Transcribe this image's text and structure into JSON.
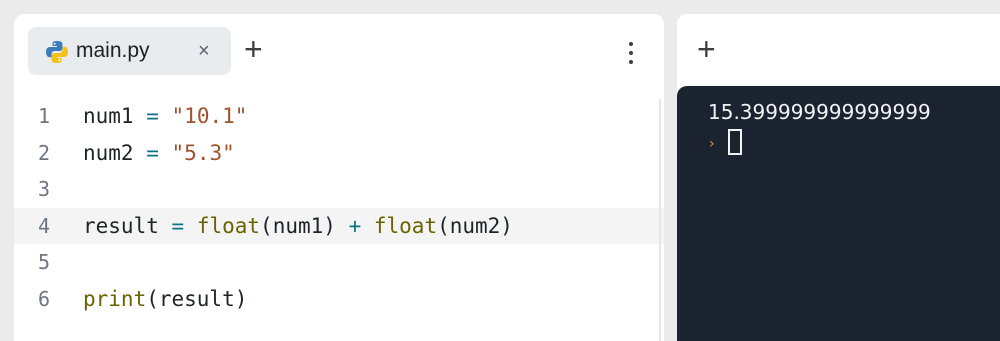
{
  "editor": {
    "tab": {
      "filename": "main.py",
      "close_glyph": "×",
      "icon": "python-icon"
    },
    "add_tab_glyph": "+",
    "menu_icon": "vertical-dots-icon",
    "active_line": 4,
    "lines": [
      {
        "num": "1",
        "tokens": [
          [
            "plain",
            "num1 "
          ],
          [
            "op",
            "="
          ],
          [
            "plain",
            " "
          ],
          [
            "str",
            "\"10.1\""
          ]
        ]
      },
      {
        "num": "2",
        "tokens": [
          [
            "plain",
            "num2 "
          ],
          [
            "op",
            "="
          ],
          [
            "plain",
            " "
          ],
          [
            "str",
            "\"5.3\""
          ]
        ]
      },
      {
        "num": "3",
        "tokens": []
      },
      {
        "num": "4",
        "tokens": [
          [
            "plain",
            "result "
          ],
          [
            "op",
            "="
          ],
          [
            "plain",
            " "
          ],
          [
            "fn",
            "float"
          ],
          [
            "plain",
            "(num1) "
          ],
          [
            "op",
            "+"
          ],
          [
            "plain",
            " "
          ],
          [
            "fn",
            "float"
          ],
          [
            "plain",
            "(num2)"
          ]
        ]
      },
      {
        "num": "5",
        "tokens": []
      },
      {
        "num": "6",
        "tokens": [
          [
            "fn",
            "print"
          ],
          [
            "plain",
            "(result)"
          ]
        ]
      }
    ]
  },
  "console": {
    "add_tab_glyph": "+",
    "output": "15.399999999999999",
    "prompt_glyph": "›"
  },
  "colors": {
    "string": "#a0522d",
    "operator": "#0b7285",
    "function": "#6b6300",
    "console_bg": "#1b2230",
    "prompt": "#d4a72c"
  }
}
